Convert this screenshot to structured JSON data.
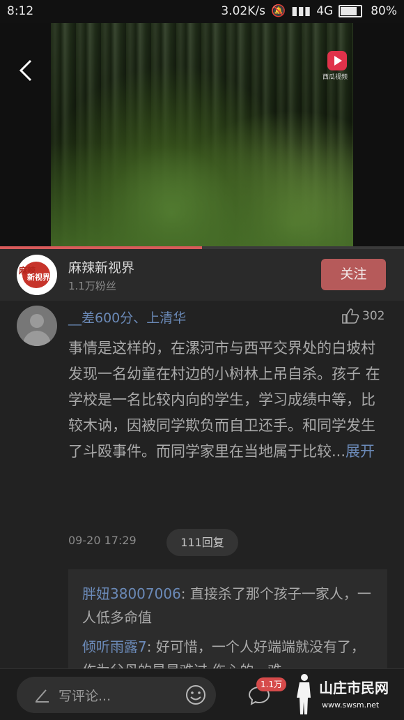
{
  "status_bar": {
    "time": "8:12",
    "speed": "3.02K/s",
    "network": "4G",
    "battery": "80%",
    "battery_level": 0.8
  },
  "video": {
    "logo_text": "西瓜视频",
    "progress": 0.5
  },
  "channel": {
    "name": "麻辣新视界",
    "fans": "1.1万粉丝",
    "follow_label": "关注",
    "avatar_text_1": "麻辣",
    "avatar_text_2": "新视界"
  },
  "comment": {
    "username": "__差600分、上清华",
    "likes": "302",
    "text": "事情是这样的，在漯河市与西平交界处的白坡村发现一名幼童在村边的小树林上吊自杀。孩子 在学校是一名比较内向的学生，学习成绩中等，比较木讷，因被同学欺负而自卫还手。和同学发生了斗殴事件。而同学家里在当地属于比较...",
    "expand": "展开",
    "timestamp": "09-20 17:29",
    "replies_label": "111回复",
    "replies": [
      {
        "user": "胖妞38007006",
        "text": ": 直接杀了那个孩子一家人，一人低多命值"
      },
      {
        "user": "倾听雨露7",
        "text": ": 好可惜，一个人好端端就没有了，作为父母的是最难过,伤心的，难"
      }
    ]
  },
  "bottom_bar": {
    "placeholder": "写评论...",
    "comment_count": "1.1万"
  },
  "watermark": {
    "text": "山庄市民网",
    "url": "www.swsm.net"
  },
  "colors": {
    "accent_blue": "#6b8ab8",
    "follow_bg": "#b65a5a",
    "badge": "#d64b4b"
  }
}
